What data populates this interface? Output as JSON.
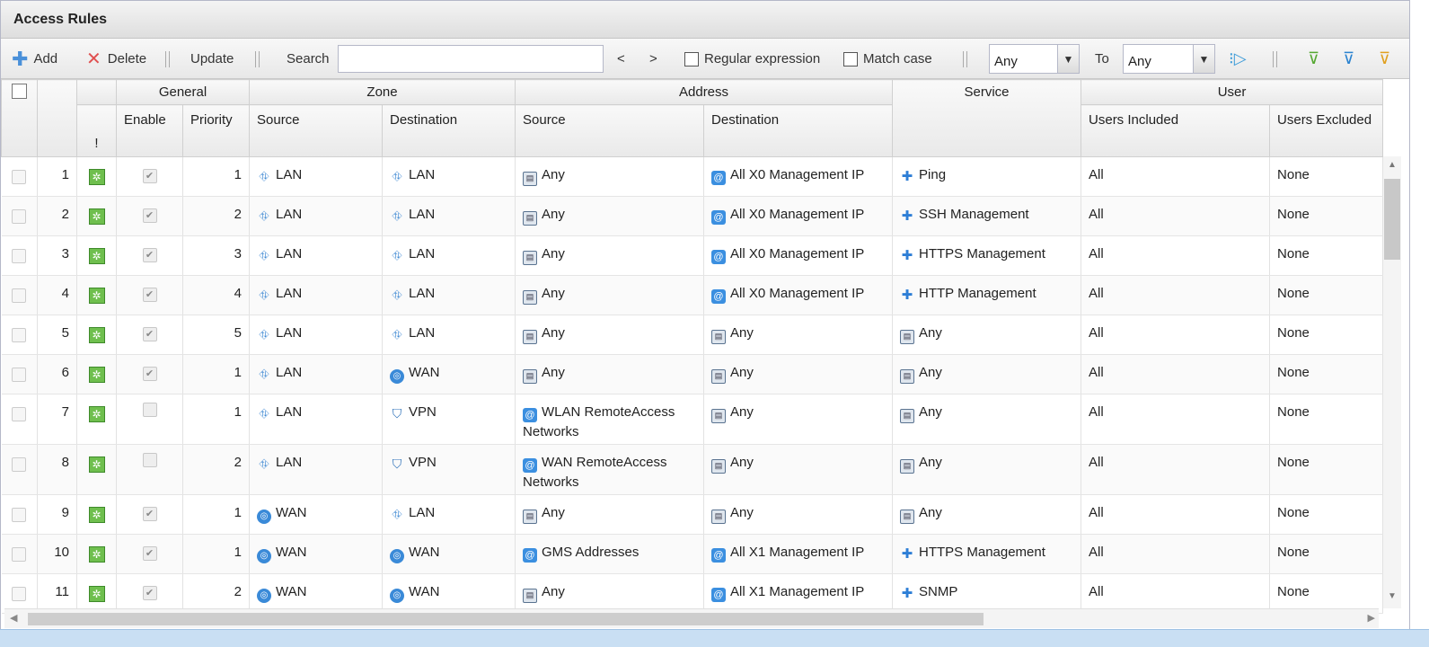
{
  "panel": {
    "title": "Access Rules"
  },
  "toolbar": {
    "add": "Add",
    "delete": "Delete",
    "update": "Update",
    "search_label": "Search",
    "search_value": "",
    "prev": "<",
    "next": ">",
    "regex": "Regular expression",
    "match_case": "Match case",
    "from_zone": "Any",
    "to_label": "To",
    "to_zone": "Any"
  },
  "columns": {
    "groups": {
      "general": "General",
      "zone": "Zone",
      "address": "Address",
      "service": "Service",
      "user": "User"
    },
    "status": "!",
    "enable": "Enable",
    "priority": "Priority",
    "zone_source": "Source",
    "zone_destination": "Destination",
    "addr_source": "Source",
    "addr_destination": "Destination",
    "users_included": "Users Included",
    "users_excluded": "Users Excluded"
  },
  "rows": [
    {
      "num": "1",
      "enabled": true,
      "priority": "1",
      "src_zone": "LAN",
      "src_zone_icon": "network-icon",
      "dst_zone": "LAN",
      "dst_zone_icon": "network-icon",
      "src_addr": "Any",
      "src_addr_icon": "address-icon",
      "dst_addr": "All X0 Management IP",
      "dst_addr_icon": "address-group-icon",
      "service": "Ping",
      "service_icon": "service-icon",
      "users_in": "All",
      "users_ex": "None"
    },
    {
      "num": "2",
      "enabled": true,
      "priority": "2",
      "src_zone": "LAN",
      "src_zone_icon": "network-icon",
      "dst_zone": "LAN",
      "dst_zone_icon": "network-icon",
      "src_addr": "Any",
      "src_addr_icon": "address-icon",
      "dst_addr": "All X0 Management IP",
      "dst_addr_icon": "address-group-icon",
      "service": "SSH Management",
      "service_icon": "service-icon",
      "users_in": "All",
      "users_ex": "None"
    },
    {
      "num": "3",
      "enabled": true,
      "priority": "3",
      "src_zone": "LAN",
      "src_zone_icon": "network-icon",
      "dst_zone": "LAN",
      "dst_zone_icon": "network-icon",
      "src_addr": "Any",
      "src_addr_icon": "address-icon",
      "dst_addr": "All X0 Management IP",
      "dst_addr_icon": "address-group-icon",
      "service": "HTTPS Management",
      "service_icon": "service-icon",
      "users_in": "All",
      "users_ex": "None"
    },
    {
      "num": "4",
      "enabled": true,
      "priority": "4",
      "src_zone": "LAN",
      "src_zone_icon": "network-icon",
      "dst_zone": "LAN",
      "dst_zone_icon": "network-icon",
      "src_addr": "Any",
      "src_addr_icon": "address-icon",
      "dst_addr": "All X0 Management IP",
      "dst_addr_icon": "address-group-icon",
      "service": "HTTP Management",
      "service_icon": "service-icon",
      "users_in": "All",
      "users_ex": "None"
    },
    {
      "num": "5",
      "enabled": true,
      "priority": "5",
      "src_zone": "LAN",
      "src_zone_icon": "network-icon",
      "dst_zone": "LAN",
      "dst_zone_icon": "network-icon",
      "src_addr": "Any",
      "src_addr_icon": "address-icon",
      "dst_addr": "Any",
      "dst_addr_icon": "address-icon",
      "service": "Any",
      "service_icon": "address-icon",
      "users_in": "All",
      "users_ex": "None"
    },
    {
      "num": "6",
      "enabled": true,
      "priority": "1",
      "src_zone": "LAN",
      "src_zone_icon": "network-icon",
      "dst_zone": "WAN",
      "dst_zone_icon": "globe-icon",
      "src_addr": "Any",
      "src_addr_icon": "address-icon",
      "dst_addr": "Any",
      "dst_addr_icon": "address-icon",
      "service": "Any",
      "service_icon": "address-icon",
      "users_in": "All",
      "users_ex": "None"
    },
    {
      "num": "7",
      "enabled": false,
      "priority": "1",
      "src_zone": "LAN",
      "src_zone_icon": "network-icon",
      "dst_zone": "VPN",
      "dst_zone_icon": "shield-icon",
      "src_addr": "WLAN RemoteAccess Networks",
      "src_addr_icon": "address-group-icon",
      "dst_addr": "Any",
      "dst_addr_icon": "address-icon",
      "service": "Any",
      "service_icon": "address-icon",
      "users_in": "All",
      "users_ex": "None",
      "tall": true
    },
    {
      "num": "8",
      "enabled": false,
      "priority": "2",
      "src_zone": "LAN",
      "src_zone_icon": "network-icon",
      "dst_zone": "VPN",
      "dst_zone_icon": "shield-icon",
      "src_addr": "WAN RemoteAccess Networks",
      "src_addr_icon": "address-group-icon",
      "dst_addr": "Any",
      "dst_addr_icon": "address-icon",
      "service": "Any",
      "service_icon": "address-icon",
      "users_in": "All",
      "users_ex": "None",
      "tall": true
    },
    {
      "num": "9",
      "enabled": true,
      "priority": "1",
      "src_zone": "WAN",
      "src_zone_icon": "globe-icon",
      "dst_zone": "LAN",
      "dst_zone_icon": "network-icon",
      "src_addr": "Any",
      "src_addr_icon": "address-icon",
      "dst_addr": "Any",
      "dst_addr_icon": "address-icon",
      "service": "Any",
      "service_icon": "address-icon",
      "users_in": "All",
      "users_ex": "None"
    },
    {
      "num": "10",
      "enabled": true,
      "priority": "1",
      "src_zone": "WAN",
      "src_zone_icon": "globe-icon",
      "dst_zone": "WAN",
      "dst_zone_icon": "globe-icon",
      "src_addr": "GMS Addresses",
      "src_addr_icon": "address-group-icon",
      "dst_addr": "All X1 Management IP",
      "dst_addr_icon": "address-group-icon",
      "service": "HTTPS Management",
      "service_icon": "service-icon",
      "users_in": "All",
      "users_ex": "None"
    },
    {
      "num": "11",
      "enabled": true,
      "priority": "2",
      "src_zone": "WAN",
      "src_zone_icon": "globe-icon",
      "dst_zone": "WAN",
      "dst_zone_icon": "globe-icon",
      "src_addr": "Any",
      "src_addr_icon": "address-icon",
      "dst_addr": "All X1 Management IP",
      "dst_addr_icon": "address-group-icon",
      "service": "SNMP",
      "service_icon": "service-icon",
      "users_in": "All",
      "users_ex": "None"
    }
  ]
}
